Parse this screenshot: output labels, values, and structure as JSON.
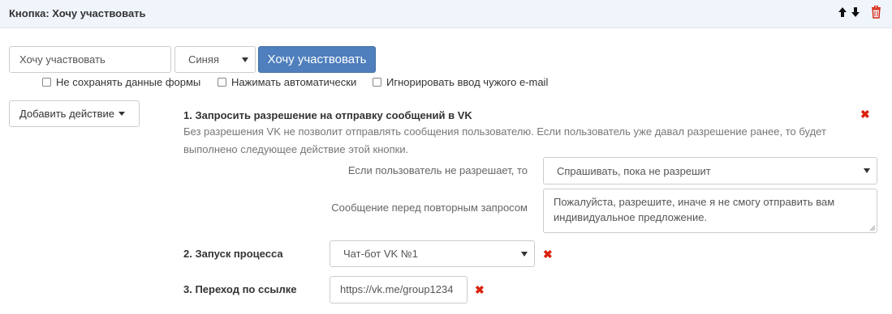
{
  "header": {
    "title": "Кнопка: Хочу участвовать"
  },
  "button_config": {
    "name_value": "Хочу участвовать",
    "color_select": "Синяя",
    "preview_label": "Хочу участвовать",
    "checkboxes": [
      {
        "label": "Не сохранять данные формы",
        "checked": false
      },
      {
        "label": "Нажимать автоматически",
        "checked": false
      },
      {
        "label": "Игнорировать ввод чужого e-mail",
        "checked": false
      }
    ]
  },
  "add_action": {
    "label": "Добавить действие"
  },
  "actions": [
    {
      "title": "1. Запросить разрешение на отправку сообщений в VK",
      "description_lines": [
        "Без разрешения VK не позволит отправлять сообщения пользователю. Если пользователь уже давал разрешение ранее, то будет",
        "выполнено следующее действие этой кнопки."
      ],
      "deny_label": "Если пользователь не разрешает, то",
      "deny_select": "Спрашивать, пока не разрешит",
      "message_label": "Сообщение перед повторным запросом",
      "message_lines": [
        "Пожалуйста, разрешите, иначе я не смогу отправить вам",
        "индивидуальное предложение."
      ]
    },
    {
      "title": "2. Запуск процесса",
      "select": "Чат-бот VK №1"
    },
    {
      "title": "3. Переход по ссылке",
      "url": "https://vk.me/group1234"
    }
  ],
  "icons": {
    "move_up": "arrow-up-icon",
    "move_down": "arrow-down-icon",
    "delete": "trash-icon",
    "remove": "close-icon"
  },
  "colors": {
    "header_bg": "#f0f4fb",
    "primary_button": "#4f7fbd",
    "danger": "#d9230f"
  }
}
